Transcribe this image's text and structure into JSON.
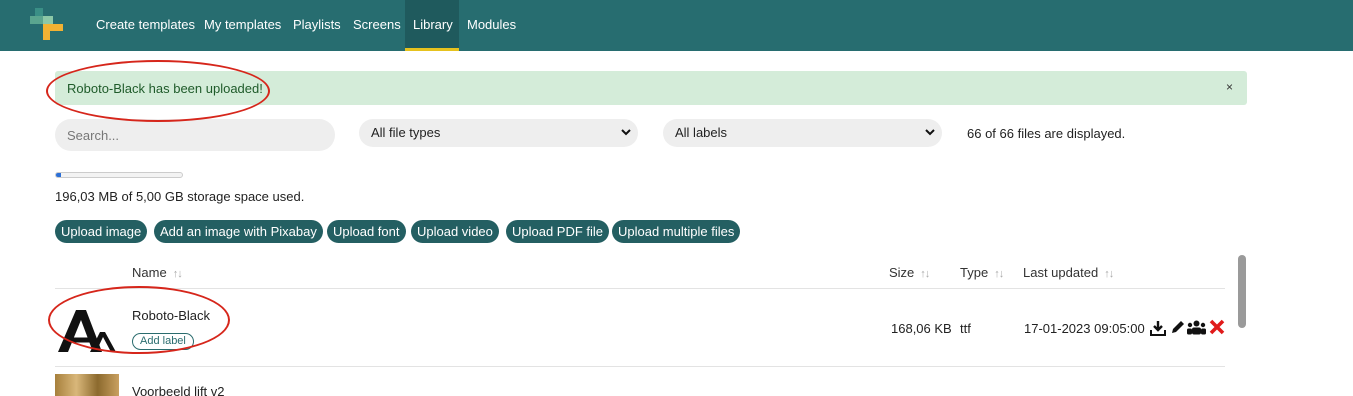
{
  "nav": {
    "items": [
      {
        "label": "Create templates"
      },
      {
        "label": "My templates"
      },
      {
        "label": "Playlists"
      },
      {
        "label": "Screens"
      },
      {
        "label": "Library"
      },
      {
        "label": "Modules"
      }
    ],
    "active": "Library"
  },
  "alert": {
    "message": "Roboto-Black has been uploaded!",
    "close": "×"
  },
  "filters": {
    "search_placeholder": "Search...",
    "file_type": "All file types",
    "labels": "All labels",
    "count_text": "66 of 66 files are displayed."
  },
  "storage": {
    "used_fraction": 0.04,
    "text": "196,03  MB of 5,00 GB storage space used."
  },
  "upload_buttons": [
    {
      "label": "Upload image"
    },
    {
      "label": "Add an image with  Pixabay"
    },
    {
      "label": "Upload font"
    },
    {
      "label": "Upload video"
    },
    {
      "label": "Upload  PDF file"
    },
    {
      "label": "Upload multiple files"
    }
  ],
  "table": {
    "headers": {
      "name": "Name",
      "size": "Size",
      "type": "Type",
      "updated": "Last updated"
    },
    "sort_glyph": "↑↓",
    "rows": [
      {
        "name": "Roboto-Black",
        "label_button": "Add label",
        "size": "168,06  KB",
        "type": "ttf",
        "updated": "17-01-2023 09:05:00"
      },
      {
        "name": "Voorbeeld lift v2"
      }
    ]
  },
  "icons": {
    "logo": "app-logo",
    "download": "download-icon",
    "edit": "pencil-icon",
    "share": "users-icon",
    "delete": "close-icon"
  },
  "colors": {
    "nav": "#276d70",
    "accent": "#e6c21e",
    "button": "#245f62",
    "alert_bg": "#d4ecd9",
    "annotation": "#d6261b",
    "delete": "#e01a1a"
  }
}
